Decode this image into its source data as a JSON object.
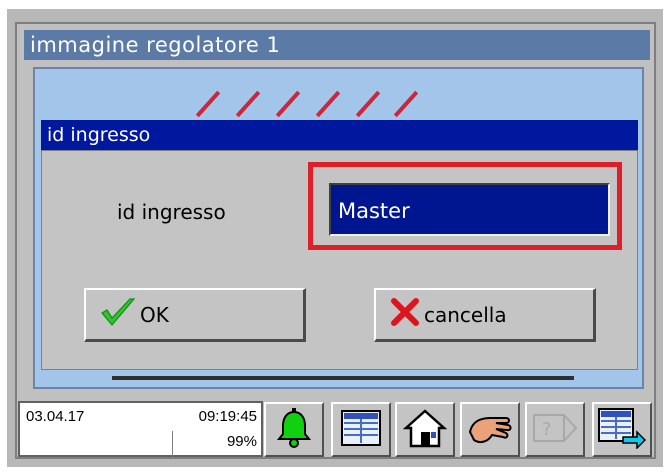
{
  "window": {
    "title": "immagine regolatore 1"
  },
  "dialog": {
    "title": "id ingresso",
    "field_label": "id ingresso",
    "field_value": "Master",
    "ok_label": "OK",
    "cancel_label": "cancella"
  },
  "status": {
    "date": "03.04.17",
    "time": "09:19:45",
    "percent": "99%"
  },
  "toolbar": {
    "buttons": [
      {
        "icon": "alarm-bell-icon"
      },
      {
        "icon": "data-table-icon"
      },
      {
        "icon": "home-icon"
      },
      {
        "icon": "hand-icon"
      },
      {
        "icon": "help-icon",
        "enabled": false
      },
      {
        "icon": "table-export-icon"
      }
    ]
  },
  "colors": {
    "title_bar": "#5c7aa6",
    "dialog_title": "#00189e",
    "input_bg": "#001590",
    "highlight": "#dd1f2a",
    "panel_bg": "#a4c5ea"
  }
}
